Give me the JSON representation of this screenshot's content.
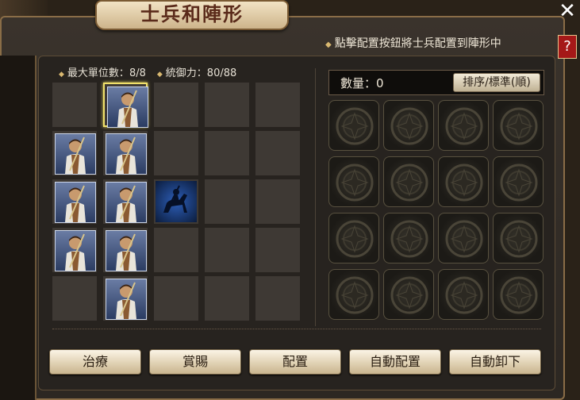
{
  "window": {
    "title": "士兵和陣形",
    "close_symbol": "✕",
    "help_symbol": "?"
  },
  "hint": {
    "bullet": "◆",
    "text": "點擊配置按鈕將士兵配置到陣形中"
  },
  "stats": {
    "bullet": "◆",
    "max_units_label": "最大單位數：",
    "max_units_value": "8/8",
    "command_label": "統御力：",
    "command_value": "80/88"
  },
  "formation": {
    "rows": 5,
    "cols": 5,
    "occupied": [
      {
        "row": 0,
        "col": 1,
        "unit": "soldier",
        "selected": true
      },
      {
        "row": 1,
        "col": 0,
        "unit": "soldier"
      },
      {
        "row": 1,
        "col": 1,
        "unit": "soldier"
      },
      {
        "row": 2,
        "col": 0,
        "unit": "soldier"
      },
      {
        "row": 2,
        "col": 1,
        "unit": "soldier"
      },
      {
        "row": 2,
        "col": 2,
        "unit": "cavalry-silhouette"
      },
      {
        "row": 3,
        "col": 0,
        "unit": "soldier"
      },
      {
        "row": 3,
        "col": 1,
        "unit": "soldier"
      },
      {
        "row": 4,
        "col": 1,
        "unit": "soldier"
      }
    ]
  },
  "inventory": {
    "count_label": "數量：",
    "count_value": "0",
    "sort_label": "排序/標準(順)",
    "rows": 4,
    "cols": 4,
    "slot_icon": "empty-slot-emblem-icon"
  },
  "buttons": {
    "heal": "治療",
    "reward": "賞賜",
    "deploy": "配置",
    "auto_deploy": "自動配置",
    "auto_remove": "自動卸下"
  },
  "colors": {
    "accent_gold": "#d9b870",
    "selected_border": "#f0e06a",
    "help_red": "#a51818"
  }
}
